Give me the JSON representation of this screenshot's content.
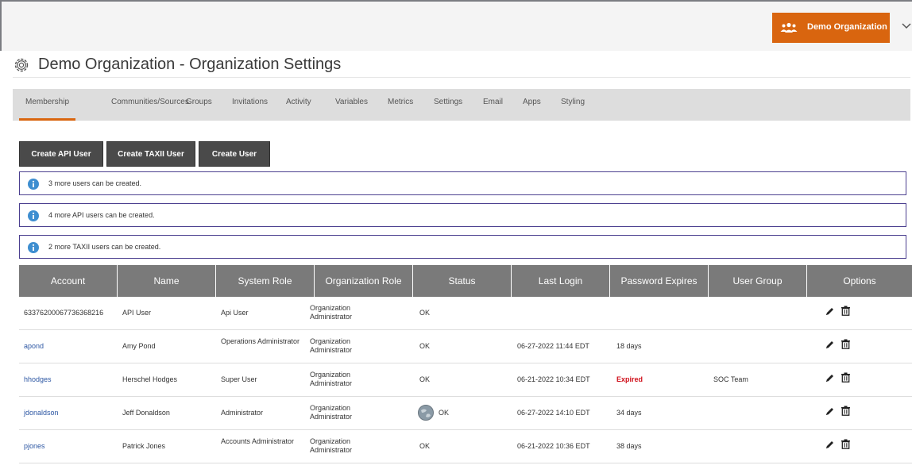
{
  "header": {
    "org_name": "Demo Organization",
    "accent_color": "#d9650f"
  },
  "page": {
    "title": "Demo Organization - Organization Settings"
  },
  "tabs": [
    {
      "label": "Membership",
      "active": true
    },
    {
      "label": "Communities/Sources",
      "active": false
    },
    {
      "label": "Groups",
      "active": false
    },
    {
      "label": "Invitations",
      "active": false
    },
    {
      "label": "Activity",
      "active": false
    },
    {
      "label": "Variables",
      "active": false
    },
    {
      "label": "Metrics",
      "active": false
    },
    {
      "label": "Settings",
      "active": false
    },
    {
      "label": "Email",
      "active": false
    },
    {
      "label": "Apps",
      "active": false
    },
    {
      "label": "Styling",
      "active": false
    }
  ],
  "actions": {
    "create_api_user": "Create API User",
    "create_taxii_user": "Create TAXII User",
    "create_user": "Create User"
  },
  "notices": [
    "3 more users can be created.",
    "4 more API users can be created.",
    "2 more TAXII users can be created."
  ],
  "table": {
    "columns": [
      "Account",
      "Name",
      "System Role",
      "Organization Role",
      "Status",
      "Last Login",
      "Password Expires",
      "User Group",
      "Options"
    ],
    "rows": [
      {
        "account": "63376200067736368216",
        "account_link": false,
        "name": "API User",
        "system_role": "Api User",
        "org_role": "Organization Administrator",
        "status": "OK",
        "avatar": false,
        "last_login": "",
        "password_expires": "",
        "expired": false,
        "user_group": ""
      },
      {
        "account": "apond",
        "account_link": true,
        "name": "Amy Pond",
        "system_role": "Operations Administrator",
        "org_role": "Organization Administrator",
        "status": "OK",
        "avatar": false,
        "last_login": "06-27-2022 11:44 EDT",
        "password_expires": "18 days",
        "expired": false,
        "user_group": ""
      },
      {
        "account": "hhodges",
        "account_link": true,
        "name": "Herschel Hodges",
        "system_role": "Super User",
        "org_role": "Organization Administrator",
        "status": "OK",
        "avatar": false,
        "last_login": "06-21-2022 10:34 EDT",
        "password_expires": "Expired",
        "expired": true,
        "user_group": "SOC Team"
      },
      {
        "account": "jdonaldson",
        "account_link": true,
        "name": "Jeff Donaldson",
        "system_role": "Administrator",
        "org_role": "Organization Administrator",
        "status": "OK",
        "avatar": true,
        "last_login": "06-27-2022 14:10 EDT",
        "password_expires": "34 days",
        "expired": false,
        "user_group": ""
      },
      {
        "account": "pjones",
        "account_link": true,
        "name": "Patrick Jones",
        "system_role": "Accounts Administrator",
        "org_role": "Organization Administrator",
        "status": "OK",
        "avatar": false,
        "last_login": "06-21-2022 10:36 EDT",
        "password_expires": "38 days",
        "expired": false,
        "user_group": ""
      }
    ]
  }
}
